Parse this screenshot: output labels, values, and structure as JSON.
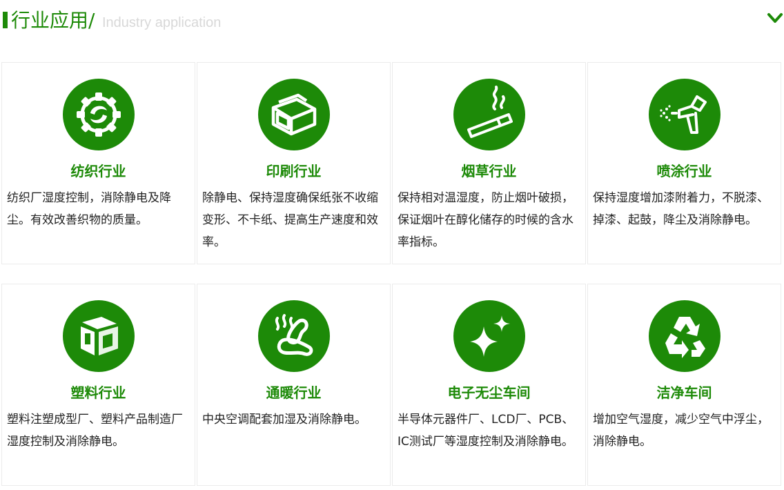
{
  "header": {
    "title": "行业应用/",
    "subtitle": "Industry application",
    "accent": "#1d8a08",
    "toggle_icon": "chevron-down-icon"
  },
  "cards": [
    {
      "title": "纺织行业",
      "desc": "纺织厂湿度控制，消除静电及降尘。有效改善织物的质量。",
      "icon": "gear-icon"
    },
    {
      "title": "印刷行业",
      "desc": "除静电、保持湿度确保纸张不收缩变形、不卡纸、提高生产速度和效率。",
      "icon": "box-icon"
    },
    {
      "title": "烟草行业",
      "desc": "保持相对温湿度，防止烟叶破损，保证烟叶在醇化储存的时候的含水率指标。",
      "icon": "cigarette-icon"
    },
    {
      "title": "喷涂行业",
      "desc": "保持湿度增加漆附着力，不脱漆、掉漆、起鼓，降尘及消除静电。",
      "icon": "spray-gun-icon"
    },
    {
      "title": "塑料行业",
      "desc": "塑料注塑成型厂、塑料产品制造厂湿度控制及消除静电。",
      "icon": "cube-icon"
    },
    {
      "title": "通暖行业",
      "desc": "中央空调配套加湿及消除静电。",
      "icon": "heating-icon"
    },
    {
      "title": "电子无尘车间",
      "desc": "半导体元器件厂、LCD厂、PCB、IC测试厂等湿度控制及消除静电。",
      "icon": "sparkle-icon"
    },
    {
      "title": "洁净车间",
      "desc": "增加空气湿度，减少空气中浮尘，消除静电。",
      "icon": "recycle-icon"
    }
  ]
}
